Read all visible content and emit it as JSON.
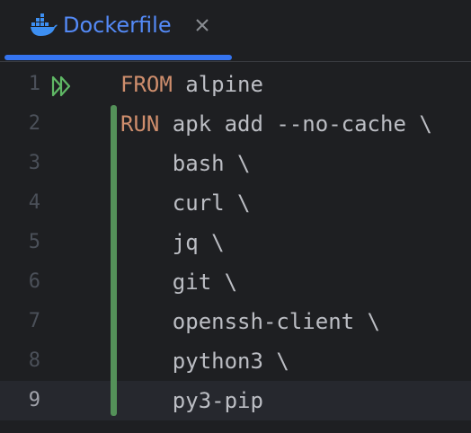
{
  "tab": {
    "title": "Dockerfile",
    "icon": "docker-whale-icon",
    "close_icon": "close-icon",
    "accent_color": "#548af7",
    "underline_color": "#3574f0"
  },
  "editor": {
    "current_line": 9,
    "colors": {
      "keyword": "#cf8e6d",
      "text": "#bcbec4",
      "line_number": "#4b5059",
      "change_bar": "#549159",
      "run_icon": "#5fb865"
    },
    "lines": [
      {
        "number": "1",
        "keyword": "FROM",
        "text": " alpine"
      },
      {
        "number": "2",
        "keyword": "RUN",
        "text": " apk add --no-cache \\"
      },
      {
        "number": "3",
        "keyword": "",
        "text": "    bash \\"
      },
      {
        "number": "4",
        "keyword": "",
        "text": "    curl \\"
      },
      {
        "number": "5",
        "keyword": "",
        "text": "    jq \\"
      },
      {
        "number": "6",
        "keyword": "",
        "text": "    git \\"
      },
      {
        "number": "7",
        "keyword": "",
        "text": "    openssh-client \\"
      },
      {
        "number": "8",
        "keyword": "",
        "text": "    python3 \\"
      },
      {
        "number": "9",
        "keyword": "",
        "text": "    py3-pip"
      }
    ]
  }
}
